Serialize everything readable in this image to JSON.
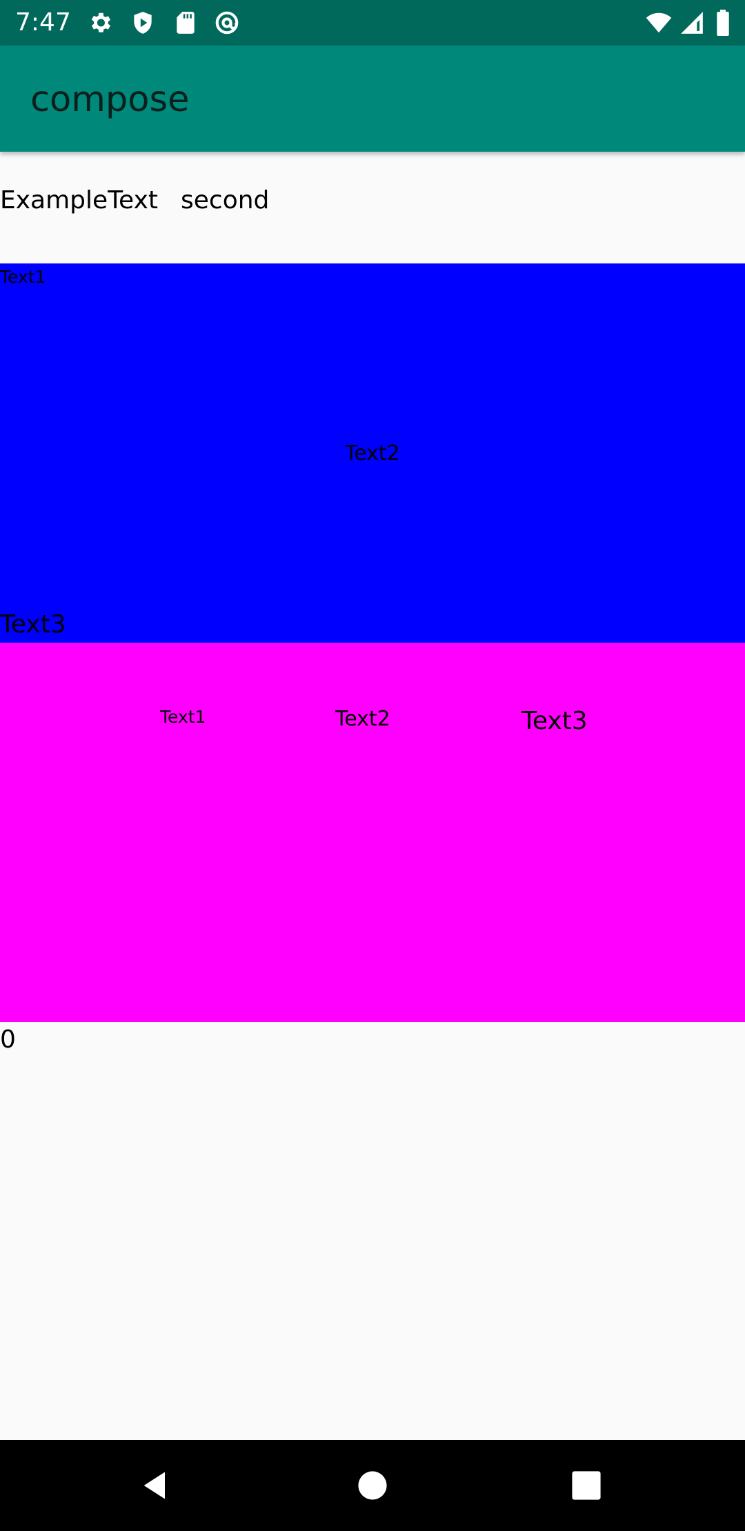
{
  "status_bar": {
    "time": "7:47",
    "background": "#00695c",
    "icons_left": [
      "gear-icon",
      "shield-icon",
      "sd-card-icon",
      "at-sign-icon"
    ],
    "icons_right": [
      "wifi-icon",
      "cell-signal-icon",
      "battery-icon"
    ]
  },
  "app_bar": {
    "title": "compose",
    "background": "#00897b"
  },
  "row": {
    "first": "ExampleText",
    "second": "second"
  },
  "blue_box": {
    "color": "#0000ff",
    "text1": "Text1",
    "text2": "Text2",
    "text3": "Text3"
  },
  "magenta_box": {
    "color": "#ff00ff",
    "text1": "Text1",
    "text2": "Text2",
    "text3": "Text3"
  },
  "counter": "0",
  "nav_bar": {
    "buttons": [
      "back-icon",
      "home-icon",
      "recents-icon"
    ]
  }
}
